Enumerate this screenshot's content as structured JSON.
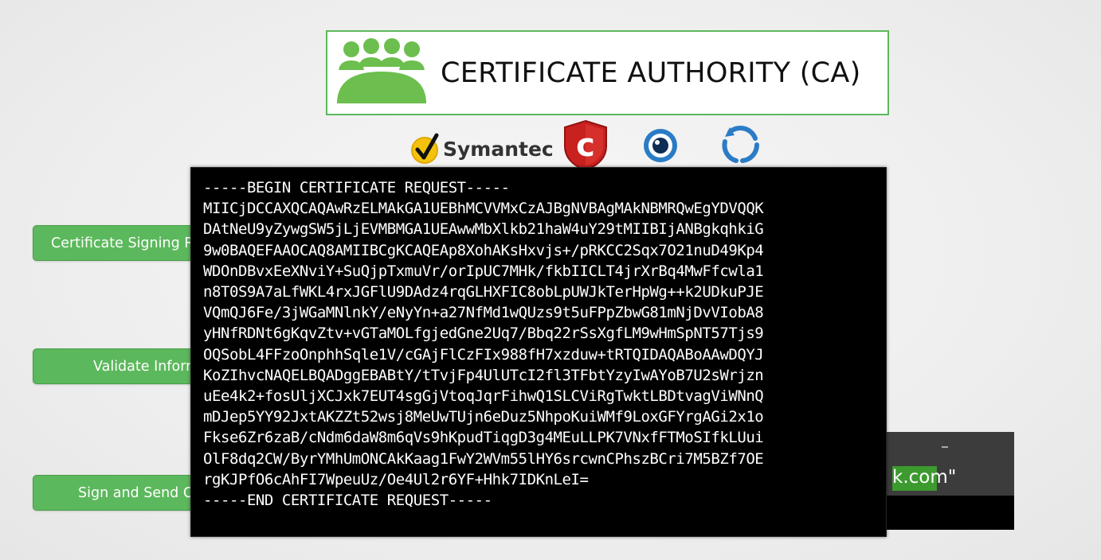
{
  "ca": {
    "title": "CERTIFICATE AUTHORITY (CA)",
    "icon": "people-group-icon",
    "accent_color": "#5cb85c"
  },
  "logos": {
    "symantec": "Symantec",
    "comodo_letter": "c"
  },
  "buttons": {
    "csr": "Certificate Signing Re",
    "validate": "Validate Inforr",
    "sign": "Sign and Send C"
  },
  "right_panel": {
    "domain_text": "k.com\""
  },
  "terminal": {
    "lines": [
      "-----BEGIN CERTIFICATE REQUEST-----",
      "MIICjDCCAXQCAQAwRzELMAkGA1UEBhMCVVMxCzAJBgNVBAgMAkNBMRQwEgYDVQQK",
      "DAtNeU9yZywgSW5jLjEVMBMGA1UEAwwMbXlkb21haW4uY29tMIIBIjANBgkqhkiG",
      "9w0BAQEFAAOCAQ8AMIIBCgKCAQEAp8XohAKsHxvjs+/pRKCC2Sqx7O21nuD49Kp4",
      "WDOnDBvxEeXNviY+SuQjpTxmuVr/orIpUC7MHk/fkbIICLT4jrXrBq4MwFfcwla1",
      "n8T0S9A7aLfWKL4rxJGFlU9DAdz4rqGLHXFIC8obLpUWJkTerHpWg++k2UDkuPJE",
      "VQmQJ6Fe/3jWGaMNlnkY/eNyYn+a27NfMd1wQUzs9t5uFPpZbwG81mNjDvVIobA8",
      "yHNfRDNt6gKqvZtv+vGTaMOLfgjedGne2Uq7/Bbq22rSsXgfLM9wHmSpNT57Tjs9",
      "OQSobL4FFzoOnphhSqle1V/cGAjFlCzFIx988fH7xzduw+tRTQIDAQABoAAwDQYJ",
      "KoZIhvcNAQELBQADggEBABtY/tTvjFp4UlUTcI2fl3TFbtYzyIwAYoB7U2sWrjzn",
      "uEe4k2+fosUljXCJxk7EUT4sgGjVtoqJqrFihwQ1SLCViRgTwktLBDtvagViWNnQ",
      "mDJep5YY92JxtAKZZt52wsj8MeUwTUjn6eDuz5NhpoKuiWMf9LoxGFYrgAGi2x1o",
      "Fkse6Zr6zaB/cNdm6daW8m6qVs9hKpudTiqgD3g4MEuLLPK7VNxfFTMoSIfkLUui",
      "OlF8dq2CW/ByrYMhUmONCAkKaag1FwY2WVm55lHY6srcwnCPhszBCri7M5BZf7OE",
      "rgKJPfO6cAhFI7WpeuUz/Oe4Ul2r6YF+Hhk7IDKnLeI=",
      "-----END CERTIFICATE REQUEST-----"
    ]
  }
}
